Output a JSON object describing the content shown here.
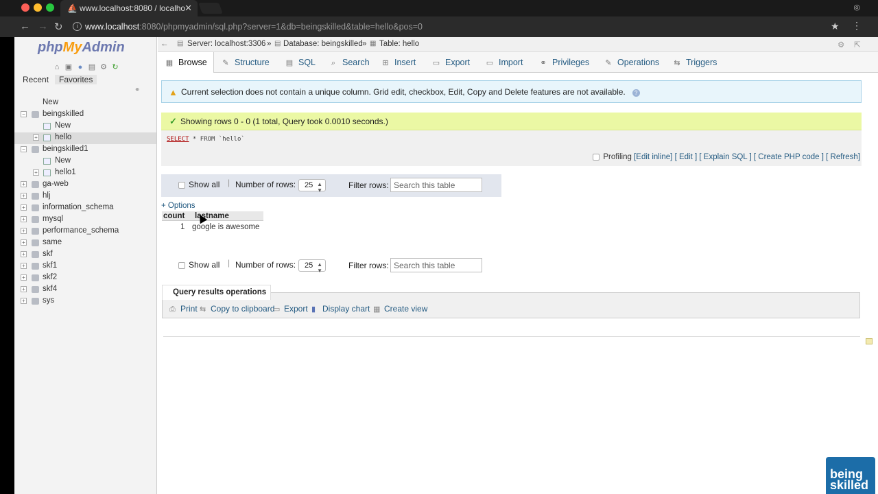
{
  "browser": {
    "tab_title": "www.localhost:8080 / localho",
    "url_host": "www.localhost",
    "url_rest": ":8080/phpmyadmin/sql.php?server=1&db=beingskilled&table=hello&pos=0"
  },
  "nav": {
    "logo_php": "php",
    "logo_my": "My",
    "logo_admin": "Admin",
    "tab_recent": "Recent",
    "tab_favorites": "Favorites",
    "tree": [
      "New",
      "beingskilled",
      "New",
      "hello",
      "beingskilled1",
      "New",
      "hello1",
      "ga-web",
      "hlj",
      "information_schema",
      "mysql",
      "performance_schema",
      "same",
      "skf",
      "skf1",
      "skf2",
      "skf4",
      "sys"
    ]
  },
  "breadcrumb": {
    "server": "Server: localhost:3306",
    "database": "Database: beingskilled",
    "table": "Table: hello",
    "sep": "»"
  },
  "tabs": [
    "Browse",
    "Structure",
    "SQL",
    "Search",
    "Insert",
    "Export",
    "Import",
    "Privileges",
    "Operations",
    "Triggers"
  ],
  "warning": "Current selection does not contain a unique column. Grid edit, checkbox, Edit, Copy and Delete features are not available.",
  "success": "Showing rows 0 - 0 (1 total, Query took 0.0010 seconds.)",
  "sql": {
    "kw": "SELECT",
    "rest": " * FROM `hello`"
  },
  "profiling": {
    "label": "Profiling",
    "links": [
      "[Edit inline]",
      "[ Edit ]",
      "[ Explain SQL ]",
      "[ Create PHP code ]",
      "[ Refresh]"
    ]
  },
  "controls": {
    "show_all": "Show all",
    "num_rows_label": "Number of rows:",
    "num_rows_value": "25",
    "filter_label": "Filter rows:",
    "filter_placeholder": "Search this table"
  },
  "options_link": "+ Options",
  "table": {
    "columns": [
      "count",
      "lastname"
    ],
    "rows": [
      [
        "1",
        "google is awesome"
      ]
    ]
  },
  "query_ops": {
    "title": "Query results operations",
    "items": [
      "Print",
      "Copy to clipboard",
      "Export",
      "Display chart",
      "Create view"
    ]
  },
  "watermark": {
    "line1": "being",
    "line2": "skilled"
  },
  "colors": {
    "link": "#235a81",
    "success_bg": "#ebf8a4",
    "warning_bg": "#e8f5fb",
    "logo_blue": "#6c78af",
    "logo_orange": "#f89c0e"
  }
}
